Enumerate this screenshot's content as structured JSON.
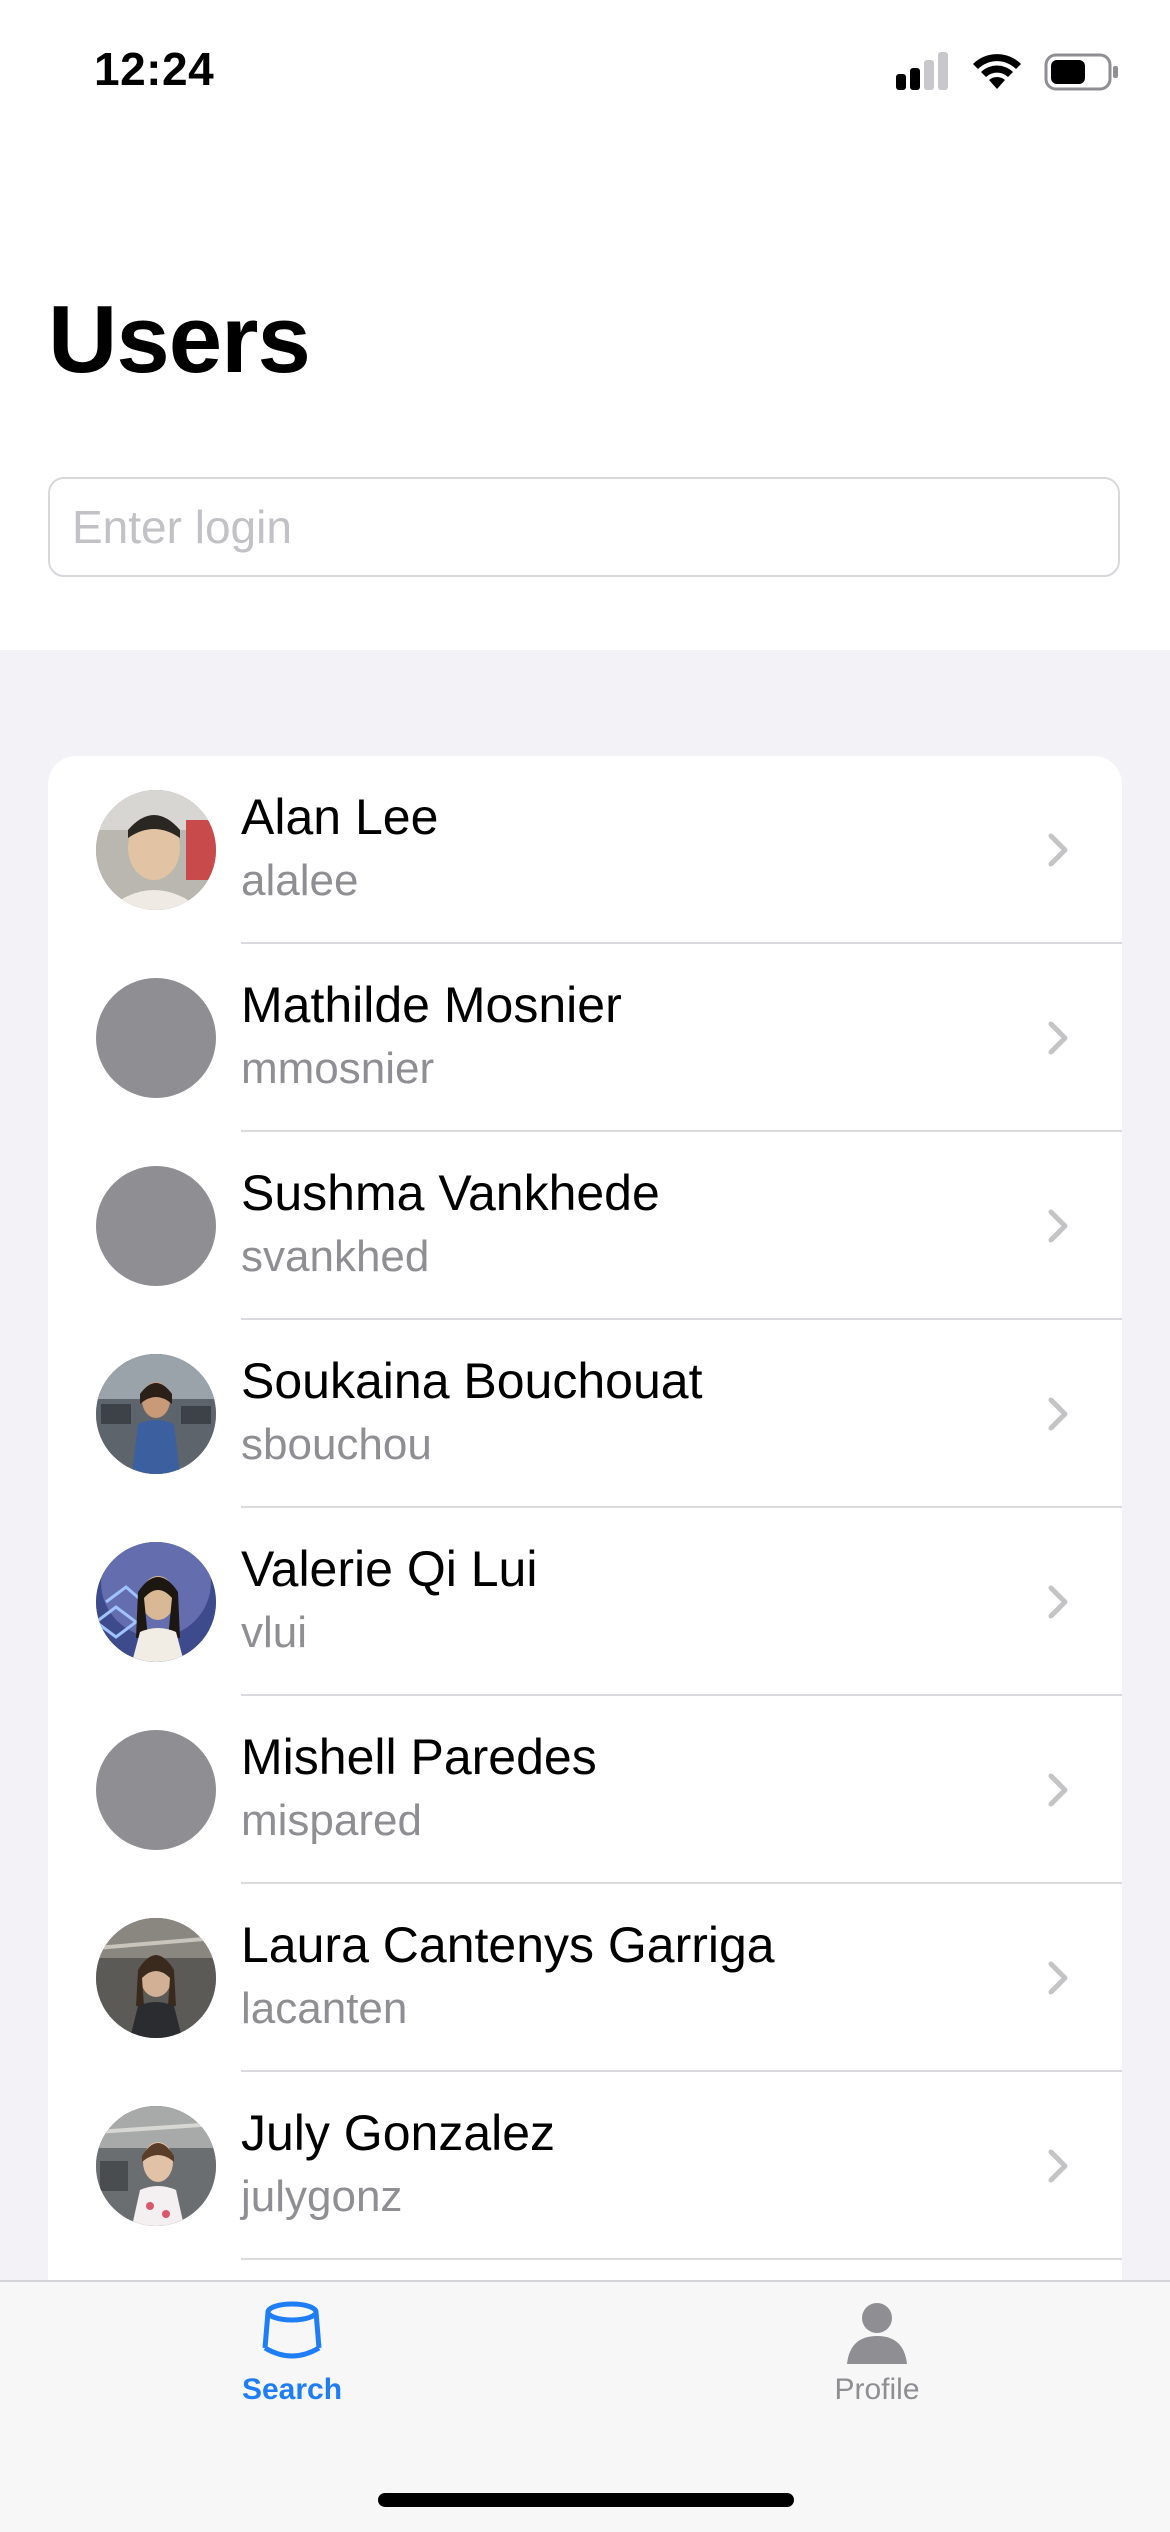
{
  "status_bar": {
    "time": "12:24"
  },
  "header": {
    "title": "Users"
  },
  "search": {
    "placeholder": "Enter login",
    "value": ""
  },
  "users": [
    {
      "name": "Alan Lee",
      "login": "alalee",
      "avatar": "photo"
    },
    {
      "name": "Mathilde Mosnier",
      "login": "mmosnier",
      "avatar": "placeholder"
    },
    {
      "name": "Sushma Vankhede",
      "login": "svankhed",
      "avatar": "placeholder"
    },
    {
      "name": "Soukaina Bouchouat",
      "login": "sbouchou",
      "avatar": "photo"
    },
    {
      "name": "Valerie Qi Lui",
      "login": "vlui",
      "avatar": "photo"
    },
    {
      "name": "Mishell Paredes",
      "login": "mispared",
      "avatar": "placeholder"
    },
    {
      "name": "Laura Cantenys Garriga",
      "login": "lacanten",
      "avatar": "photo"
    },
    {
      "name": "July Gonzalez",
      "login": "julygonz",
      "avatar": "photo"
    }
  ],
  "tabbar": {
    "tabs": [
      {
        "label": "Search",
        "icon": "search-tab-icon",
        "selected": true
      },
      {
        "label": "Profile",
        "icon": "person-icon",
        "selected": false
      }
    ]
  },
  "colors": {
    "accent": "#1f7ef5",
    "secondary_text": "#8e8e93",
    "background": "#f2f2f7"
  }
}
